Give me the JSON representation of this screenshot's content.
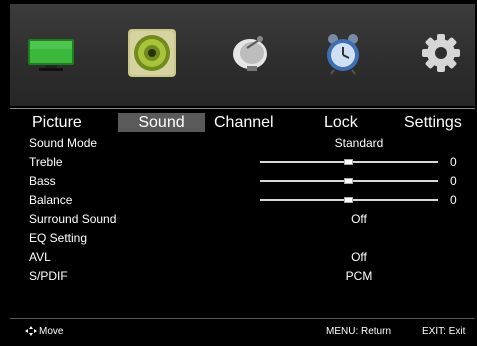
{
  "categories": [
    {
      "icon": "tv-icon",
      "color": "#2e9a2e"
    },
    {
      "icon": "speaker-icon",
      "color": "#b8c26a"
    },
    {
      "icon": "satellite-dish-icon",
      "color": "#cccccc"
    },
    {
      "icon": "alarm-clock-icon",
      "color": "#4a7fc0"
    },
    {
      "icon": "gear-icon",
      "color": "#d0d0d0"
    }
  ],
  "tabs": {
    "picture": "Picture",
    "sound": "Sound",
    "channel": "Channel",
    "lock": "Lock",
    "settings": "Settings",
    "active": "Sound"
  },
  "rows": {
    "sound_mode": {
      "label": "Sound Mode",
      "value": "Standard"
    },
    "treble": {
      "label": "Treble",
      "value": "0",
      "level": 0
    },
    "bass": {
      "label": "Bass",
      "value": "0",
      "level": 0
    },
    "balance": {
      "label": "Balance",
      "value": "0",
      "level": 0
    },
    "surround": {
      "label": "Surround Sound",
      "value": "Off"
    },
    "eq": {
      "label": "EQ Setting"
    },
    "avl": {
      "label": "AVL",
      "value": "Off"
    },
    "spdif": {
      "label": "S/PDIF",
      "value": "PCM"
    }
  },
  "footer": {
    "move": "Move",
    "return": "MENU: Return",
    "exit": "EXIT: Exit"
  }
}
